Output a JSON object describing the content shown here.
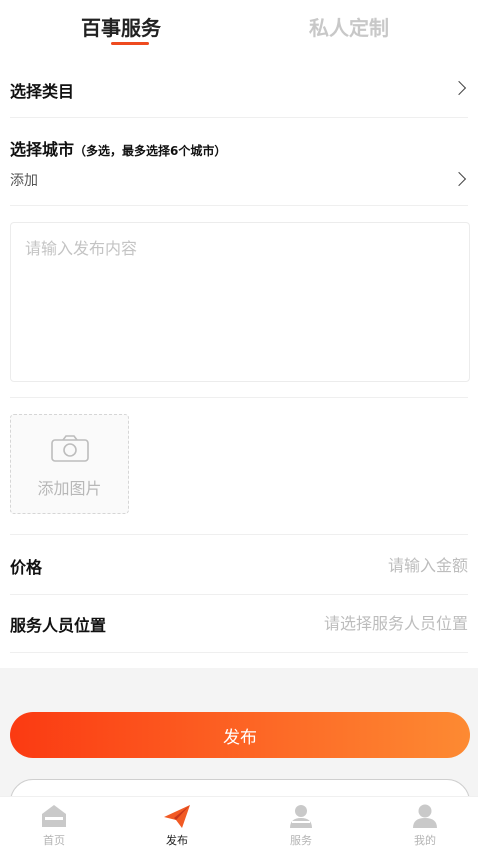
{
  "tabs": [
    {
      "label": "百事服务",
      "active": true
    },
    {
      "label": "私人定制",
      "active": false
    }
  ],
  "form": {
    "category": {
      "label": "选择类目"
    },
    "city": {
      "label": "选择城市",
      "hint": "（多选，最多选择6个城市）",
      "value": "添加"
    },
    "content": {
      "placeholder": "请输入发布内容"
    },
    "image": {
      "label": "添加图片"
    },
    "price": {
      "label": "价格",
      "placeholder": "请输入金额"
    },
    "location": {
      "label": "服务人员位置",
      "placeholder": "请选择服务人员位置"
    }
  },
  "actions": {
    "publish_label": "发布"
  },
  "tabbar": [
    {
      "label": "首页",
      "icon": "home-icon",
      "active": false
    },
    {
      "label": "发布",
      "icon": "paper-plane-icon",
      "active": true
    },
    {
      "label": "服务",
      "icon": "service-person-icon",
      "active": false
    },
    {
      "label": "我的",
      "icon": "user-icon",
      "active": false
    }
  ],
  "colors": {
    "accent": "#ee4a1f",
    "gradient_start": "#fb3a12",
    "gradient_end": "#fd8a32"
  }
}
